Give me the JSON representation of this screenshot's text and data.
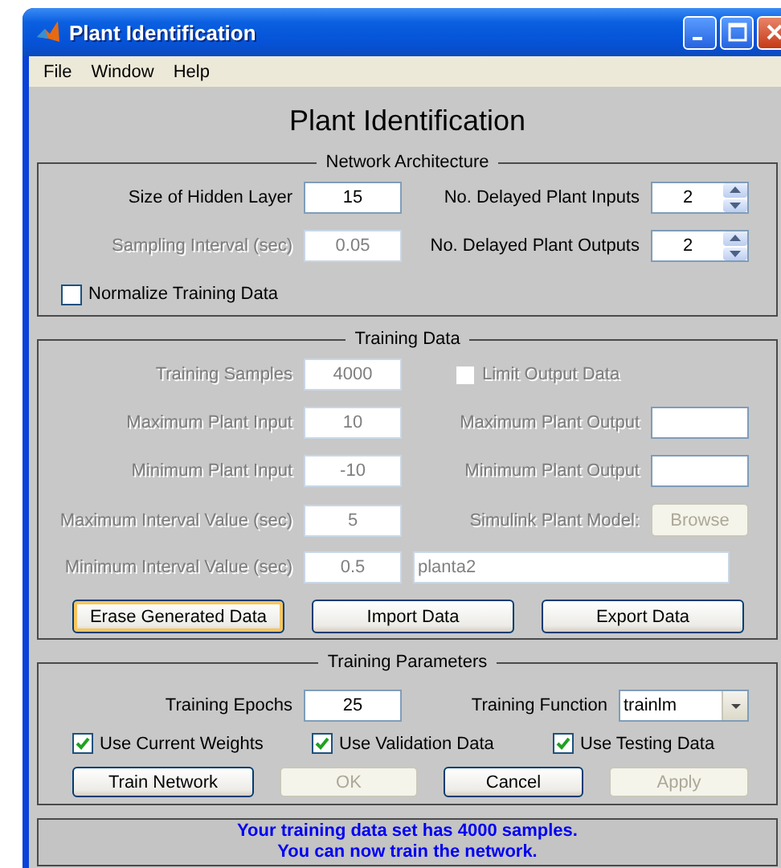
{
  "window": {
    "title": "Plant Identification"
  },
  "menu": [
    {
      "label": "File"
    },
    {
      "label": "Window"
    },
    {
      "label": "Help"
    }
  ],
  "heading": "Plant Identification",
  "sections": [
    {
      "title": "Network Architecture",
      "rows": [
        {
          "kind": "fields",
          "items": [
            {
              "kind": "label",
              "text": "Size of Hidden Layer",
              "disabled": false
            },
            {
              "kind": "field",
              "value": "15",
              "disabled": false
            },
            {
              "kind": "label",
              "text": "No. Delayed Plant Inputs",
              "disabled": false
            },
            {
              "kind": "spinner",
              "value": "2",
              "disabled": false
            }
          ]
        },
        {
          "kind": "fields",
          "items": [
            {
              "kind": "label",
              "text": "Sampling Interval (sec)",
              "disabled": true
            },
            {
              "kind": "field",
              "value": "0.05",
              "disabled": true
            },
            {
              "kind": "label",
              "text": "No. Delayed Plant Outputs",
              "disabled": false
            },
            {
              "kind": "spinner",
              "value": "2",
              "disabled": false
            }
          ]
        },
        {
          "kind": "fields",
          "items": [
            {
              "kind": "checkbox",
              "label": "Normalize Training Data",
              "checked": false,
              "disabled": false
            }
          ]
        }
      ]
    },
    {
      "title": "Training Data",
      "rows": [
        {
          "kind": "fields",
          "items": [
            {
              "kind": "label",
              "text": "Training Samples",
              "disabled": true
            },
            {
              "kind": "field",
              "value": "4000",
              "disabled": true
            },
            {
              "kind": "checkbox",
              "label": "Limit Output Data",
              "checked": false,
              "disabled": true
            }
          ]
        },
        {
          "kind": "fields",
          "items": [
            {
              "kind": "label",
              "text": "Maximum Plant Input",
              "disabled": true
            },
            {
              "kind": "field",
              "value": "10",
              "disabled": true
            },
            {
              "kind": "label",
              "text": "Maximum Plant Output",
              "disabled": true
            },
            {
              "kind": "field",
              "disabled": false
            }
          ]
        },
        {
          "kind": "fields",
          "items": [
            {
              "kind": "label",
              "text": "Minimum Plant Input",
              "disabled": true
            },
            {
              "kind": "field",
              "value": "-10",
              "disabled": true
            },
            {
              "kind": "label",
              "text": "Minimum Plant Output",
              "disabled": true
            },
            {
              "kind": "field",
              "disabled": false
            }
          ]
        },
        {
          "kind": "fields",
          "items": [
            {
              "kind": "label",
              "text": "Maximum Interval Value (sec)",
              "disabled": true
            },
            {
              "kind": "field",
              "value": "5",
              "disabled": true
            },
            {
              "kind": "label",
              "text": "Simulink Plant Model:",
              "disabled": true
            },
            {
              "kind": "button",
              "label": "Browse",
              "disabled": true,
              "focused": false
            }
          ]
        },
        {
          "kind": "fields",
          "items": [
            {
              "kind": "label",
              "text": "Minimum Interval Value (sec)",
              "disabled": true
            },
            {
              "kind": "field",
              "value": "0.5",
              "disabled": true
            },
            {
              "kind": "widefield",
              "value": "planta2",
              "disabled": true
            }
          ]
        },
        {
          "kind": "buttons",
          "items": [
            {
              "kind": "button",
              "label": "Erase Generated Data",
              "disabled": false,
              "focused": true
            },
            {
              "kind": "button",
              "label": "Import Data",
              "disabled": false,
              "focused": false
            },
            {
              "kind": "button",
              "label": "Export Data",
              "disabled": false,
              "focused": false
            }
          ]
        }
      ]
    },
    {
      "title": "Training Parameters",
      "rows": [
        {
          "kind": "fields",
          "items": [
            {
              "kind": "label",
              "text": "Training Epochs",
              "disabled": false
            },
            {
              "kind": "field",
              "value": "25",
              "disabled": false
            },
            {
              "kind": "label",
              "text": "Training Function",
              "disabled": false
            },
            {
              "kind": "dropdown",
              "value": "trainlm",
              "disabled": false
            }
          ]
        },
        {
          "kind": "checks",
          "items": [
            {
              "kind": "checkbox",
              "label": "Use Current Weights",
              "checked": true,
              "disabled": false
            },
            {
              "kind": "checkbox",
              "label": "Use Validation Data",
              "checked": true,
              "disabled": false
            },
            {
              "kind": "checkbox",
              "label": "Use Testing Data",
              "checked": true,
              "disabled": false
            }
          ]
        },
        {
          "kind": "buttons4",
          "items": [
            {
              "kind": "button",
              "label": "Train Network",
              "disabled": false,
              "focused": false
            },
            {
              "kind": "button",
              "label": "OK",
              "disabled": true,
              "focused": false
            },
            {
              "kind": "button",
              "label": "Cancel",
              "disabled": false,
              "focused": false
            },
            {
              "kind": "button",
              "label": "Apply",
              "disabled": true,
              "focused": false
            }
          ]
        }
      ]
    }
  ],
  "status": [
    "Your training data set has 4000 samples.",
    "You can now train the network."
  ]
}
